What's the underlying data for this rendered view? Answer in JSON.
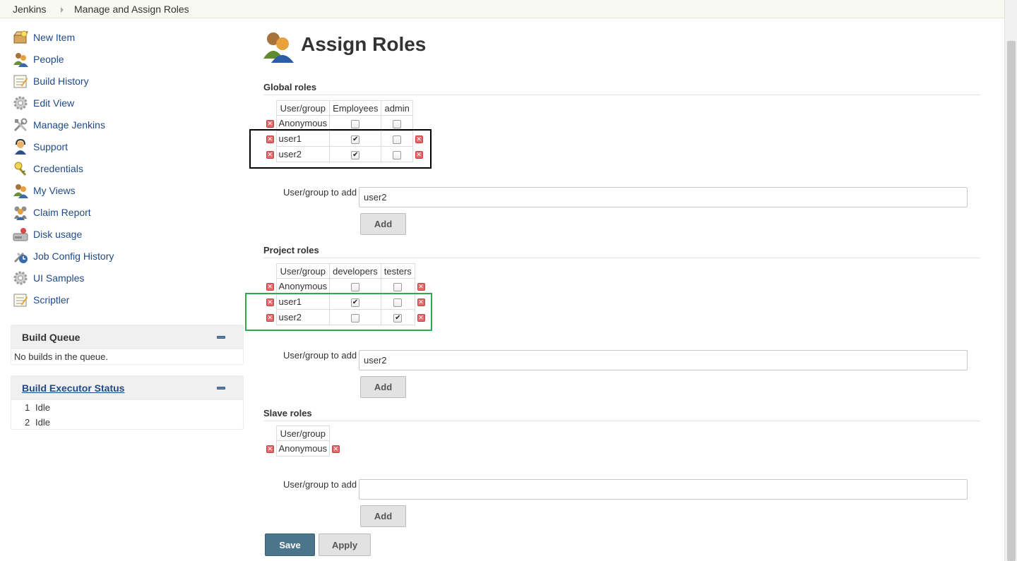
{
  "breadcrumb": [
    "Jenkins",
    "Manage and Assign Roles"
  ],
  "sidebar": {
    "tasks": [
      {
        "label": "New Item",
        "icon": "new-item-icon"
      },
      {
        "label": "People",
        "icon": "people-icon"
      },
      {
        "label": "Build History",
        "icon": "notepad-icon"
      },
      {
        "label": "Edit View",
        "icon": "gear-icon"
      },
      {
        "label": "Manage Jenkins",
        "icon": "tools-icon"
      },
      {
        "label": "Support",
        "icon": "support-icon"
      },
      {
        "label": "Credentials",
        "icon": "credentials-icon"
      },
      {
        "label": "My Views",
        "icon": "people-icon"
      },
      {
        "label": "Claim Report",
        "icon": "claim-icon"
      },
      {
        "label": "Disk usage",
        "icon": "disk-icon"
      },
      {
        "label": "Job Config History",
        "icon": "config-history-icon"
      },
      {
        "label": "UI Samples",
        "icon": "gear-icon"
      },
      {
        "label": "Scriptler",
        "icon": "notepad-icon"
      }
    ],
    "build_queue": {
      "title": "Build Queue",
      "empty_text": "No builds in the queue."
    },
    "executor_status": {
      "title": "Build Executor Status",
      "executors": [
        {
          "num": "1",
          "status": "Idle"
        },
        {
          "num": "2",
          "status": "Idle"
        }
      ]
    }
  },
  "main": {
    "title": "Assign Roles",
    "global_roles": {
      "title": "Global roles",
      "header": "User/group",
      "columns": [
        "Employees",
        "admin"
      ],
      "rows": [
        {
          "name": "Anonymous",
          "checks": [
            false,
            false
          ]
        },
        {
          "name": "user1",
          "checks": [
            true,
            false
          ]
        },
        {
          "name": "user2",
          "checks": [
            true,
            false
          ]
        }
      ],
      "add_label": "User/group to add",
      "add_value": "user2",
      "add_button": "Add"
    },
    "project_roles": {
      "title": "Project roles",
      "header": "User/group",
      "columns": [
        "developers",
        "testers"
      ],
      "rows": [
        {
          "name": "Anonymous",
          "checks": [
            false,
            false
          ]
        },
        {
          "name": "user1",
          "checks": [
            true,
            false
          ]
        },
        {
          "name": "user2",
          "checks": [
            false,
            true
          ]
        }
      ],
      "add_label": "User/group to add",
      "add_value": "user2",
      "add_button": "Add"
    },
    "slave_roles": {
      "title": "Slave roles",
      "header": "User/group",
      "columns": [],
      "rows": [
        {
          "name": "Anonymous",
          "checks": []
        }
      ],
      "add_label": "User/group to add",
      "add_value": "",
      "add_button": "Add"
    },
    "save_button": "Save",
    "apply_button": "Apply"
  },
  "icons": {
    "remove": "remove-icon",
    "check_mark": "✔",
    "remove_glyph": "✕",
    "collapse": "minus-icon"
  },
  "colors": {
    "link": "#204a87",
    "save_button": "#4b758b",
    "highlight_global": "#000000",
    "highlight_project": "#2fa84f",
    "remove": "#e4696b"
  }
}
